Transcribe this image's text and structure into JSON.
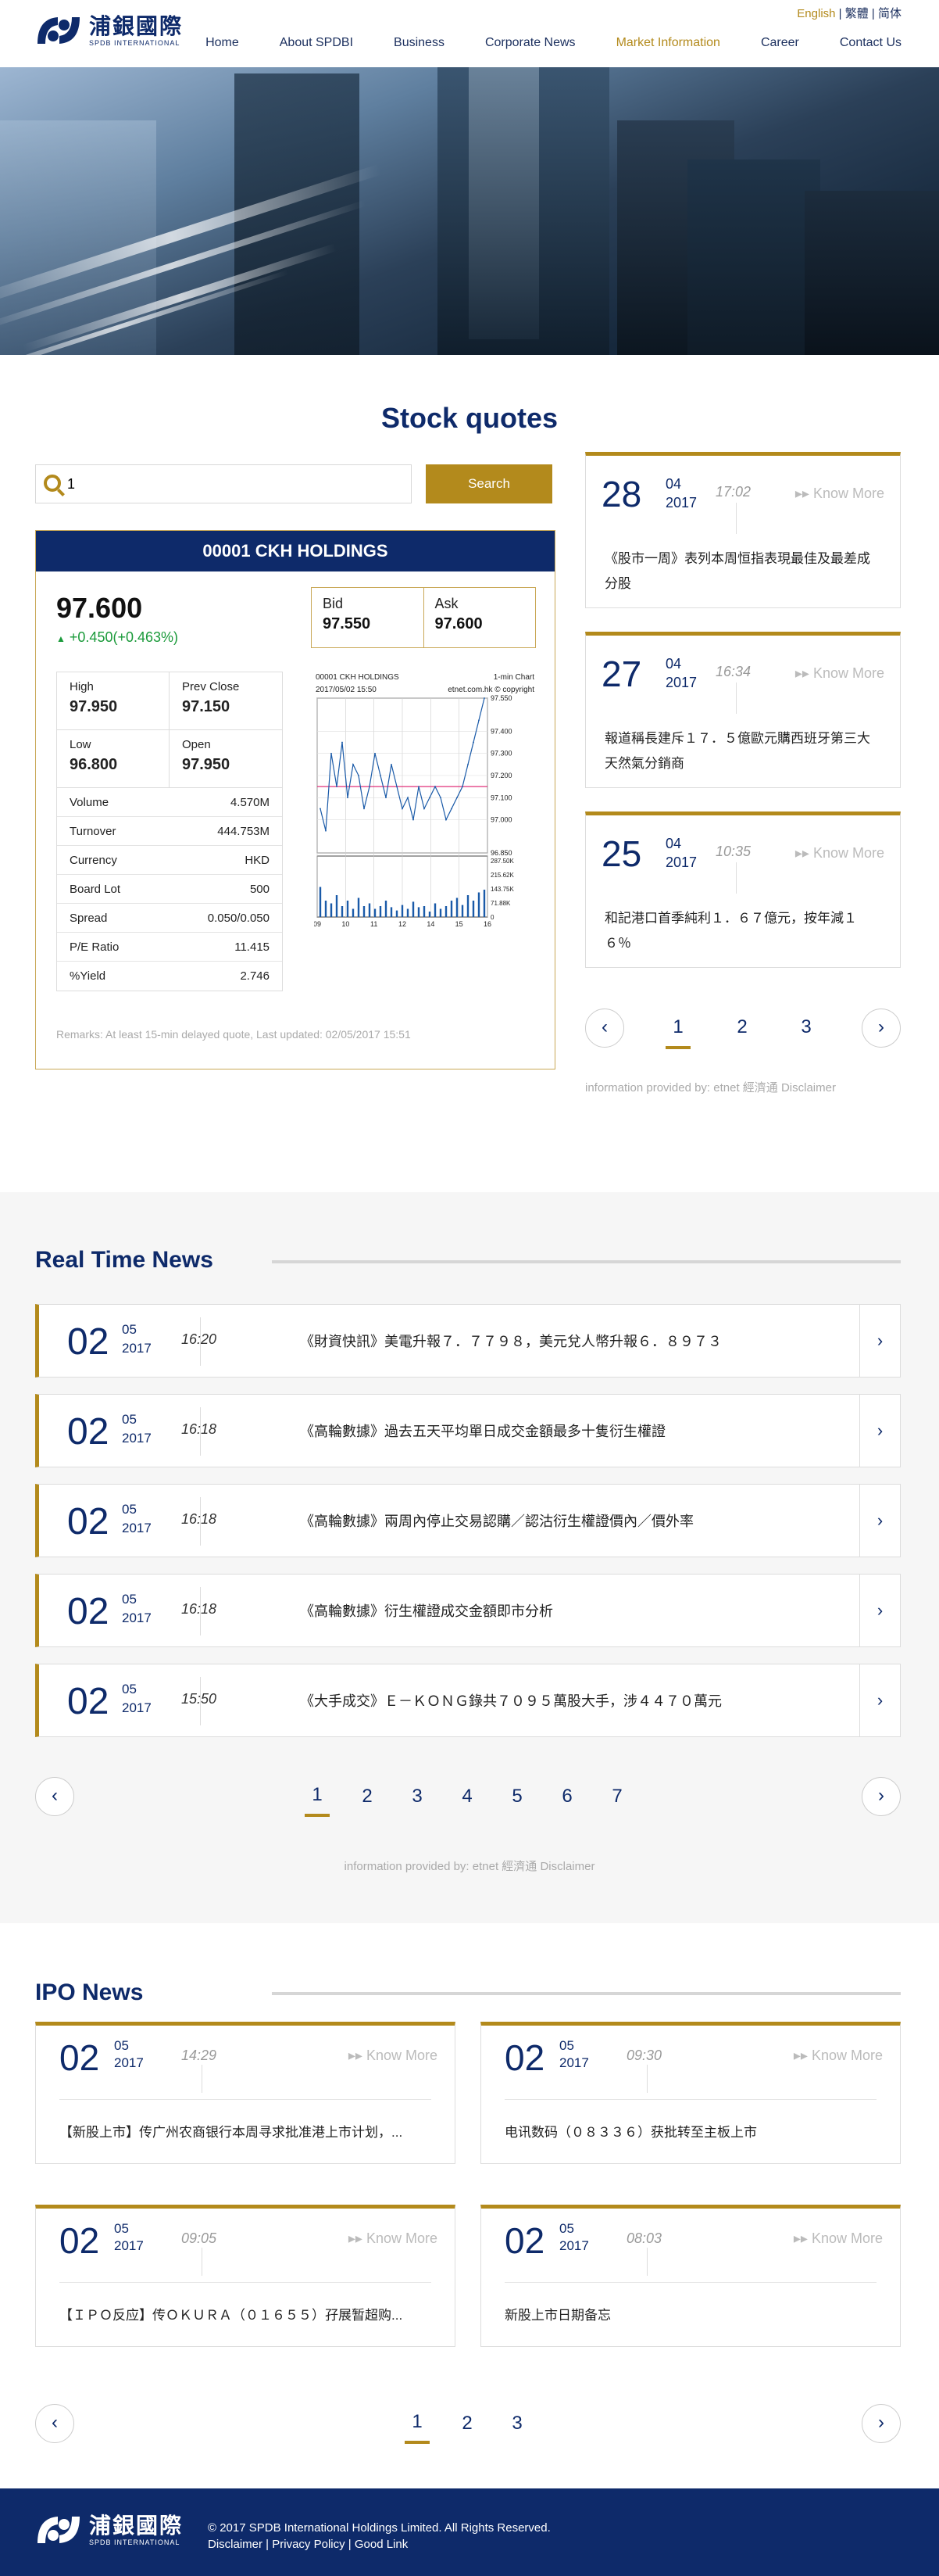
{
  "header": {
    "logo_zh": "浦銀國際",
    "logo_en": "SPDB INTERNATIONAL",
    "lang": [
      "English",
      "繁體",
      "简体"
    ],
    "nav": [
      "Home",
      "About SPDBI",
      "Business",
      "Corporate News",
      "Market Information",
      "Career",
      "Contact Us"
    ]
  },
  "stock": {
    "title": "Stock quotes",
    "search_value": "1",
    "search_button": "Search",
    "name": "00001 CKH HOLDINGS",
    "price": "97.600",
    "change": "+0.450(+0.463%)",
    "bid_label": "Bid",
    "bid": "97.550",
    "ask_label": "Ask",
    "ask": "97.600",
    "grid": [
      {
        "label": "High",
        "value": "97.950"
      },
      {
        "label": "Prev Close",
        "value": "97.150"
      },
      {
        "label": "Low",
        "value": "96.800"
      },
      {
        "label": "Open",
        "value": "97.950"
      }
    ],
    "rows": [
      {
        "label": "Volume",
        "value": "4.570M"
      },
      {
        "label": "Turnover",
        "value": "444.753M"
      },
      {
        "label": "Currency",
        "value": "HKD"
      },
      {
        "label": "Board Lot",
        "value": "500"
      },
      {
        "label": "Spread",
        "value": "0.050/0.050"
      },
      {
        "label": "P/E Ratio",
        "value": "11.415"
      },
      {
        "label": "%Yield",
        "value": "2.746"
      }
    ],
    "remarks": "Remarks: At least 15-min delayed quote, Last updated: 02/05/2017 15:51"
  },
  "chart_data": {
    "type": "line",
    "title": "00001 CKH HOLDINGS",
    "chart_label": "1-min Chart",
    "timestamp": "2017/05/02 15:50",
    "source": "etnet.com.hk © copyright",
    "x_ticks": [
      "09",
      "10",
      "11",
      "12",
      "14",
      "15",
      "16"
    ],
    "y_ticks": [
      "97.550",
      "97.400",
      "97.300",
      "97.200",
      "97.100",
      "97.000",
      "96.850"
    ],
    "volume_ticks": [
      "287.50K",
      "215.62K",
      "143.75K",
      "71.88K",
      "0"
    ],
    "ylim": [
      96.85,
      97.55
    ],
    "prev_close": 97.15,
    "series": [
      {
        "values": [
          97.05,
          96.95,
          97.3,
          97.15,
          97.35,
          97.1,
          97.25,
          97.2,
          97.05,
          97.15,
          97.3,
          97.2,
          97.1,
          97.25,
          97.15,
          97.05,
          97.1,
          97.0,
          97.15,
          97.05,
          97.1,
          97.15,
          97.1,
          97.0,
          97.05,
          97.1,
          97.15,
          97.25,
          97.35,
          97.45,
          97.55
        ]
      }
    ],
    "volume": [
      0.55,
      0.3,
      0.25,
      0.4,
      0.2,
      0.3,
      0.15,
      0.35,
      0.2,
      0.25,
      0.15,
      0.2,
      0.3,
      0.18,
      0.12,
      0.22,
      0.15,
      0.28,
      0.18,
      0.2,
      0.1,
      0.25,
      0.15,
      0.2,
      0.3,
      0.35,
      0.22,
      0.4,
      0.3,
      0.45,
      0.5
    ]
  },
  "side_news": [
    {
      "day": "28",
      "month": "04",
      "year": "2017",
      "time": "17:02",
      "more": "Know More",
      "text": "《股市一周》表列本周恒指表現最佳及最差成分股"
    },
    {
      "day": "27",
      "month": "04",
      "year": "2017",
      "time": "16:34",
      "more": "Know More",
      "text": "報道稱長建斥１７．５億歐元購西班牙第三大天然氣分銷商"
    },
    {
      "day": "25",
      "month": "04",
      "year": "2017",
      "time": "10:35",
      "more": "Know More",
      "text": "和記港口首季純利１．６７億元，按年減１６％"
    }
  ],
  "side_pager": [
    "1",
    "2",
    "3"
  ],
  "provided_by": "information provided by: etnet 經濟通 Disclaimer",
  "realtime": {
    "title": "Real Time News",
    "items": [
      {
        "day": "02",
        "month": "05",
        "year": "2017",
        "time": "16:20",
        "title": "《財資快訊》美電升報７．７７９８，美元兌人幣升報６．８９７３"
      },
      {
        "day": "02",
        "month": "05",
        "year": "2017",
        "time": "16:18",
        "title": "《高輪數據》過去五天平均單日成交金額最多十隻衍生權證"
      },
      {
        "day": "02",
        "month": "05",
        "year": "2017",
        "time": "16:18",
        "title": "《高輪數據》兩周內停止交易認購／認沽衍生權證價內／價外率"
      },
      {
        "day": "02",
        "month": "05",
        "year": "2017",
        "time": "16:18",
        "title": "《高輪數據》衍生權證成交金額即市分析"
      },
      {
        "day": "02",
        "month": "05",
        "year": "2017",
        "time": "15:50",
        "title": "《大手成交》Ｅ－ＫＯＮＧ錄共７０９５萬股大手，涉４４７０萬元"
      }
    ],
    "pager": [
      "1",
      "2",
      "3",
      "4",
      "5",
      "6",
      "7"
    ]
  },
  "ipo": {
    "title": "IPO News",
    "items": [
      {
        "day": "02",
        "month": "05",
        "year": "2017",
        "time": "14:29",
        "more": "Know More",
        "text": "【新股上市】传广州农商银行本周寻求批准港上市计划，..."
      },
      {
        "day": "02",
        "month": "05",
        "year": "2017",
        "time": "09:30",
        "more": "Know More",
        "text": "电讯数码（０８３３６）获批转至主板上市"
      },
      {
        "day": "02",
        "month": "05",
        "year": "2017",
        "time": "09:05",
        "more": "Know More",
        "text": "【ＩＰＯ反应】传ＯＫＵＲＡ（０１６５５）孖展暂超购..."
      },
      {
        "day": "02",
        "month": "05",
        "year": "2017",
        "time": "08:03",
        "more": "Know More",
        "text": "新股上市日期备忘"
      }
    ],
    "pager": [
      "1",
      "2",
      "3"
    ]
  },
  "footer": {
    "logo_zh": "浦銀國際",
    "logo_en": "SPDB INTERNATIONAL",
    "copyright": "© 2017 SPDB International Holdings Limited. All Rights Reserved.",
    "links": [
      "Disclaimer",
      "Privacy Policy",
      "Good Link"
    ]
  },
  "colors": {
    "navy": "#0e2a6a",
    "gold": "#b38a1c",
    "green": "#1a9a3a"
  }
}
